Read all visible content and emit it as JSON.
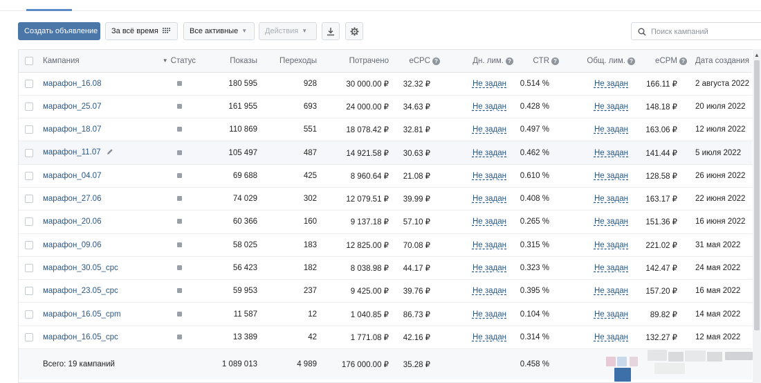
{
  "toolbar": {
    "create_label": "Создать объявление",
    "period_label": "За всё время",
    "filter_label": "Все активные",
    "actions_label": "Действия",
    "search_placeholder": "Поиск кампаний"
  },
  "table": {
    "headers": {
      "campaign": "Кампания",
      "status": "Статус",
      "impressions": "Показы",
      "clicks": "Переходы",
      "spent": "Потрачено",
      "ecpc": "eCPC",
      "daily_limit": "Дн. лим.",
      "ctr": "CTR",
      "total_limit": "Общ. лим.",
      "ecpm": "eCPM",
      "created": "Дата создания"
    },
    "rows": [
      {
        "name": "марафон_16.08",
        "impressions": "180 595",
        "clicks": "928",
        "spent": "30 000.00 ₽",
        "ecpc": "32.32 ₽",
        "daily_limit": "Не задан",
        "ctr": "0.514 %",
        "total_limit": "Не задан",
        "ecpm": "166.11 ₽",
        "created": "2 августа 2022"
      },
      {
        "name": "марафон_25.07",
        "impressions": "161 955",
        "clicks": "693",
        "spent": "24 000.00 ₽",
        "ecpc": "34.63 ₽",
        "daily_limit": "Не задан",
        "ctr": "0.428 %",
        "total_limit": "Не задан",
        "ecpm": "148.18 ₽",
        "created": "20 июля 2022"
      },
      {
        "name": "марафон_18.07",
        "impressions": "110 869",
        "clicks": "551",
        "spent": "18 078.42 ₽",
        "ecpc": "32.81 ₽",
        "daily_limit": "Не задан",
        "ctr": "0.497 %",
        "total_limit": "Не задан",
        "ecpm": "163.06 ₽",
        "created": "12 июля 2022"
      },
      {
        "name": "марафон_11.07",
        "impressions": "105 497",
        "clicks": "487",
        "spent": "14 921.58 ₽",
        "ecpc": "30.63 ₽",
        "daily_limit": "Не задан",
        "ctr": "0.462 %",
        "total_limit": "Не задан",
        "ecpm": "141.44 ₽",
        "created": "5 июля 2022"
      },
      {
        "name": "марафон_04.07",
        "impressions": "69 688",
        "clicks": "425",
        "spent": "8 960.64 ₽",
        "ecpc": "21.08 ₽",
        "daily_limit": "Не задан",
        "ctr": "0.610 %",
        "total_limit": "Не задан",
        "ecpm": "128.58 ₽",
        "created": "26 июня 2022"
      },
      {
        "name": "марафон_27.06",
        "impressions": "74 029",
        "clicks": "302",
        "spent": "12 079.51 ₽",
        "ecpc": "39.99 ₽",
        "daily_limit": "Не задан",
        "ctr": "0.408 %",
        "total_limit": "Не задан",
        "ecpm": "163.17 ₽",
        "created": "22 июня 2022"
      },
      {
        "name": "марафон_20.06",
        "impressions": "60 366",
        "clicks": "160",
        "spent": "9 137.18 ₽",
        "ecpc": "57.10 ₽",
        "daily_limit": "Не задан",
        "ctr": "0.265 %",
        "total_limit": "Не задан",
        "ecpm": "151.36 ₽",
        "created": "16 июня 2022"
      },
      {
        "name": "марафон_09.06",
        "impressions": "58 025",
        "clicks": "183",
        "spent": "12 825.00 ₽",
        "ecpc": "70.08 ₽",
        "daily_limit": "Не задан",
        "ctr": "0.315 %",
        "total_limit": "Не задан",
        "ecpm": "221.02 ₽",
        "created": "31 мая 2022"
      },
      {
        "name": "марафон_30.05_cpc",
        "impressions": "56 423",
        "clicks": "182",
        "spent": "8 038.98 ₽",
        "ecpc": "44.17 ₽",
        "daily_limit": "Не задан",
        "ctr": "0.323 %",
        "total_limit": "Не задан",
        "ecpm": "142.47 ₽",
        "created": "24 мая 2022"
      },
      {
        "name": "марафон_23.05_cpc",
        "impressions": "59 953",
        "clicks": "237",
        "spent": "9 425.00 ₽",
        "ecpc": "39.76 ₽",
        "daily_limit": "Не задан",
        "ctr": "0.395 %",
        "total_limit": "Не задан",
        "ecpm": "157.20 ₽",
        "created": "16 мая 2022"
      },
      {
        "name": "марафон_16.05_cpm",
        "impressions": "11 587",
        "clicks": "12",
        "spent": "1 040.85 ₽",
        "ecpc": "86.73 ₽",
        "daily_limit": "Не задан",
        "ctr": "0.104 %",
        "total_limit": "Не задан",
        "ecpm": "89.82 ₽",
        "created": "14 мая 2022"
      },
      {
        "name": "марафон_16.05_cpc",
        "impressions": "13 389",
        "clicks": "42",
        "spent": "1 771.08 ₽",
        "ecpc": "42.16 ₽",
        "daily_limit": "Не задан",
        "ctr": "0.314 %",
        "total_limit": "Не задан",
        "ecpm": "132.27 ₽",
        "created": "12 мая 2022"
      }
    ],
    "footer": {
      "total_label": "Всего: 19 кампаний",
      "impressions": "1 089 013",
      "clicks": "4 989",
      "spent": "176 000.00 ₽",
      "ecpc": "35.28 ₽",
      "ctr": "0.458 %"
    }
  },
  "colors": {
    "accent": "#4a76a8",
    "link": "#2a5885",
    "header_bg": "#f7f8fa"
  }
}
